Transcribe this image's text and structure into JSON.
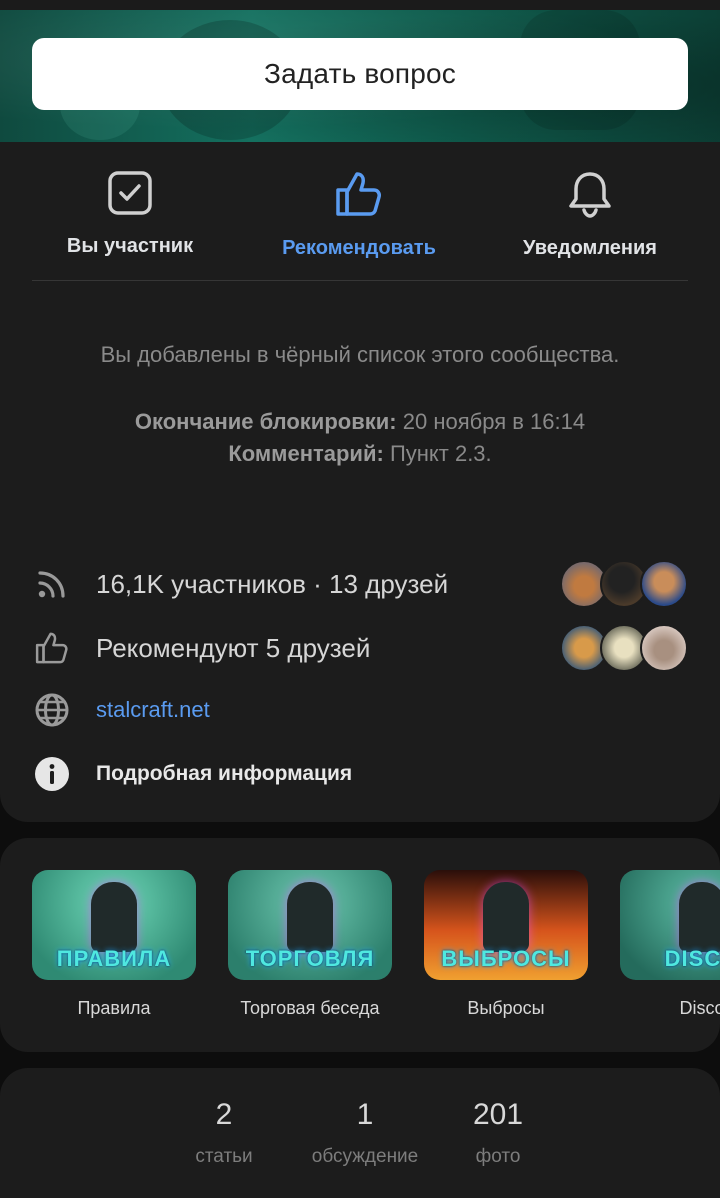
{
  "cover": {
    "ask_button": "Задать вопрос"
  },
  "actions": [
    {
      "label": "Вы участник",
      "icon": "checkbox-icon"
    },
    {
      "label": "Рекомендовать",
      "icon": "thumbs-up-icon",
      "accent": "#5a9bf0"
    },
    {
      "label": "Уведомления",
      "icon": "bell-icon"
    }
  ],
  "notice": "Вы добавлены в чёрный список этого сообщества.",
  "ban": {
    "end_label": "Окончание блокировки:",
    "end_value": "20 ноября в 16:14",
    "comment_label": "Комментарий:",
    "comment_value": "Пункт 2.3."
  },
  "info": {
    "members": "16,1K участников · 13 друзей",
    "recommend": "Рекомендуют 5 друзей",
    "website": "stalcraft.net",
    "details": "Подробная информация"
  },
  "chats": [
    {
      "name": "Правила",
      "thumb_title": "ПРАВИЛА",
      "bg": "#3fae92"
    },
    {
      "name": "Торговая беседа",
      "thumb_title": "ТОРГОВЛЯ",
      "bg": "#3a9a86"
    },
    {
      "name": "Выбросы",
      "thumb_title": "ВЫБРОСЫ",
      "bg": "#c2501c"
    },
    {
      "name": "Disco",
      "thumb_title": "DISCO",
      "bg": "#2f8f7e"
    }
  ],
  "counters": [
    {
      "value": "2",
      "label": "статьи"
    },
    {
      "value": "1",
      "label": "обсуждение"
    },
    {
      "value": "201",
      "label": "фото"
    }
  ],
  "colors": {
    "accent": "#5a9bf0",
    "card": "#1c1c1c",
    "background": "#0d0d0d"
  }
}
